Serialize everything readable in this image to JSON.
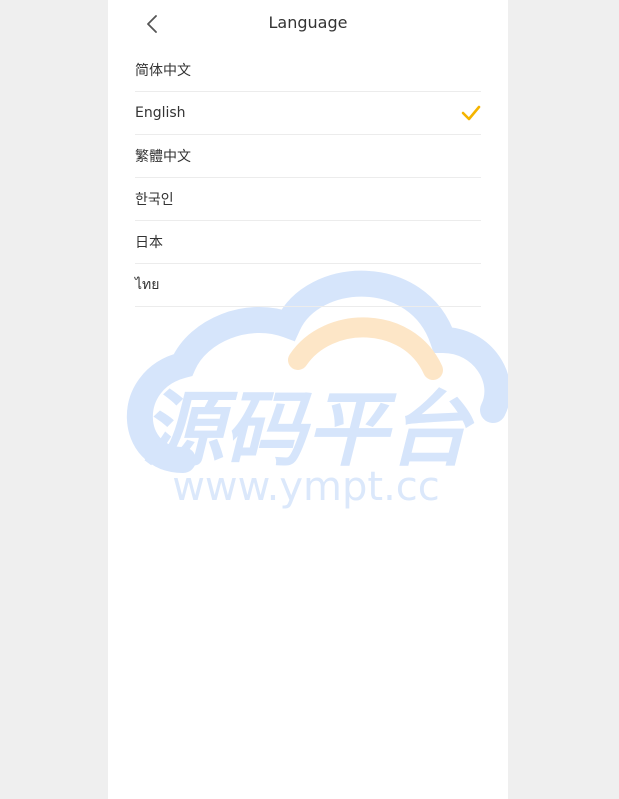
{
  "header": {
    "title": "Language"
  },
  "languages": [
    {
      "label": "简体中文",
      "selected": false
    },
    {
      "label": "English",
      "selected": true
    },
    {
      "label": "繁體中文",
      "selected": false
    },
    {
      "label": "한국인",
      "selected": false
    },
    {
      "label": "日本",
      "selected": false
    },
    {
      "label": "ไทย",
      "selected": false
    }
  ],
  "watermark": {
    "brand": "源码平台",
    "url": "www.ympt.cc"
  },
  "colors": {
    "accent": "#f5b400",
    "text": "#333333",
    "divider": "#ececec",
    "watermark_blue": "#d6e5fb",
    "watermark_orange": "#fde6c7"
  }
}
